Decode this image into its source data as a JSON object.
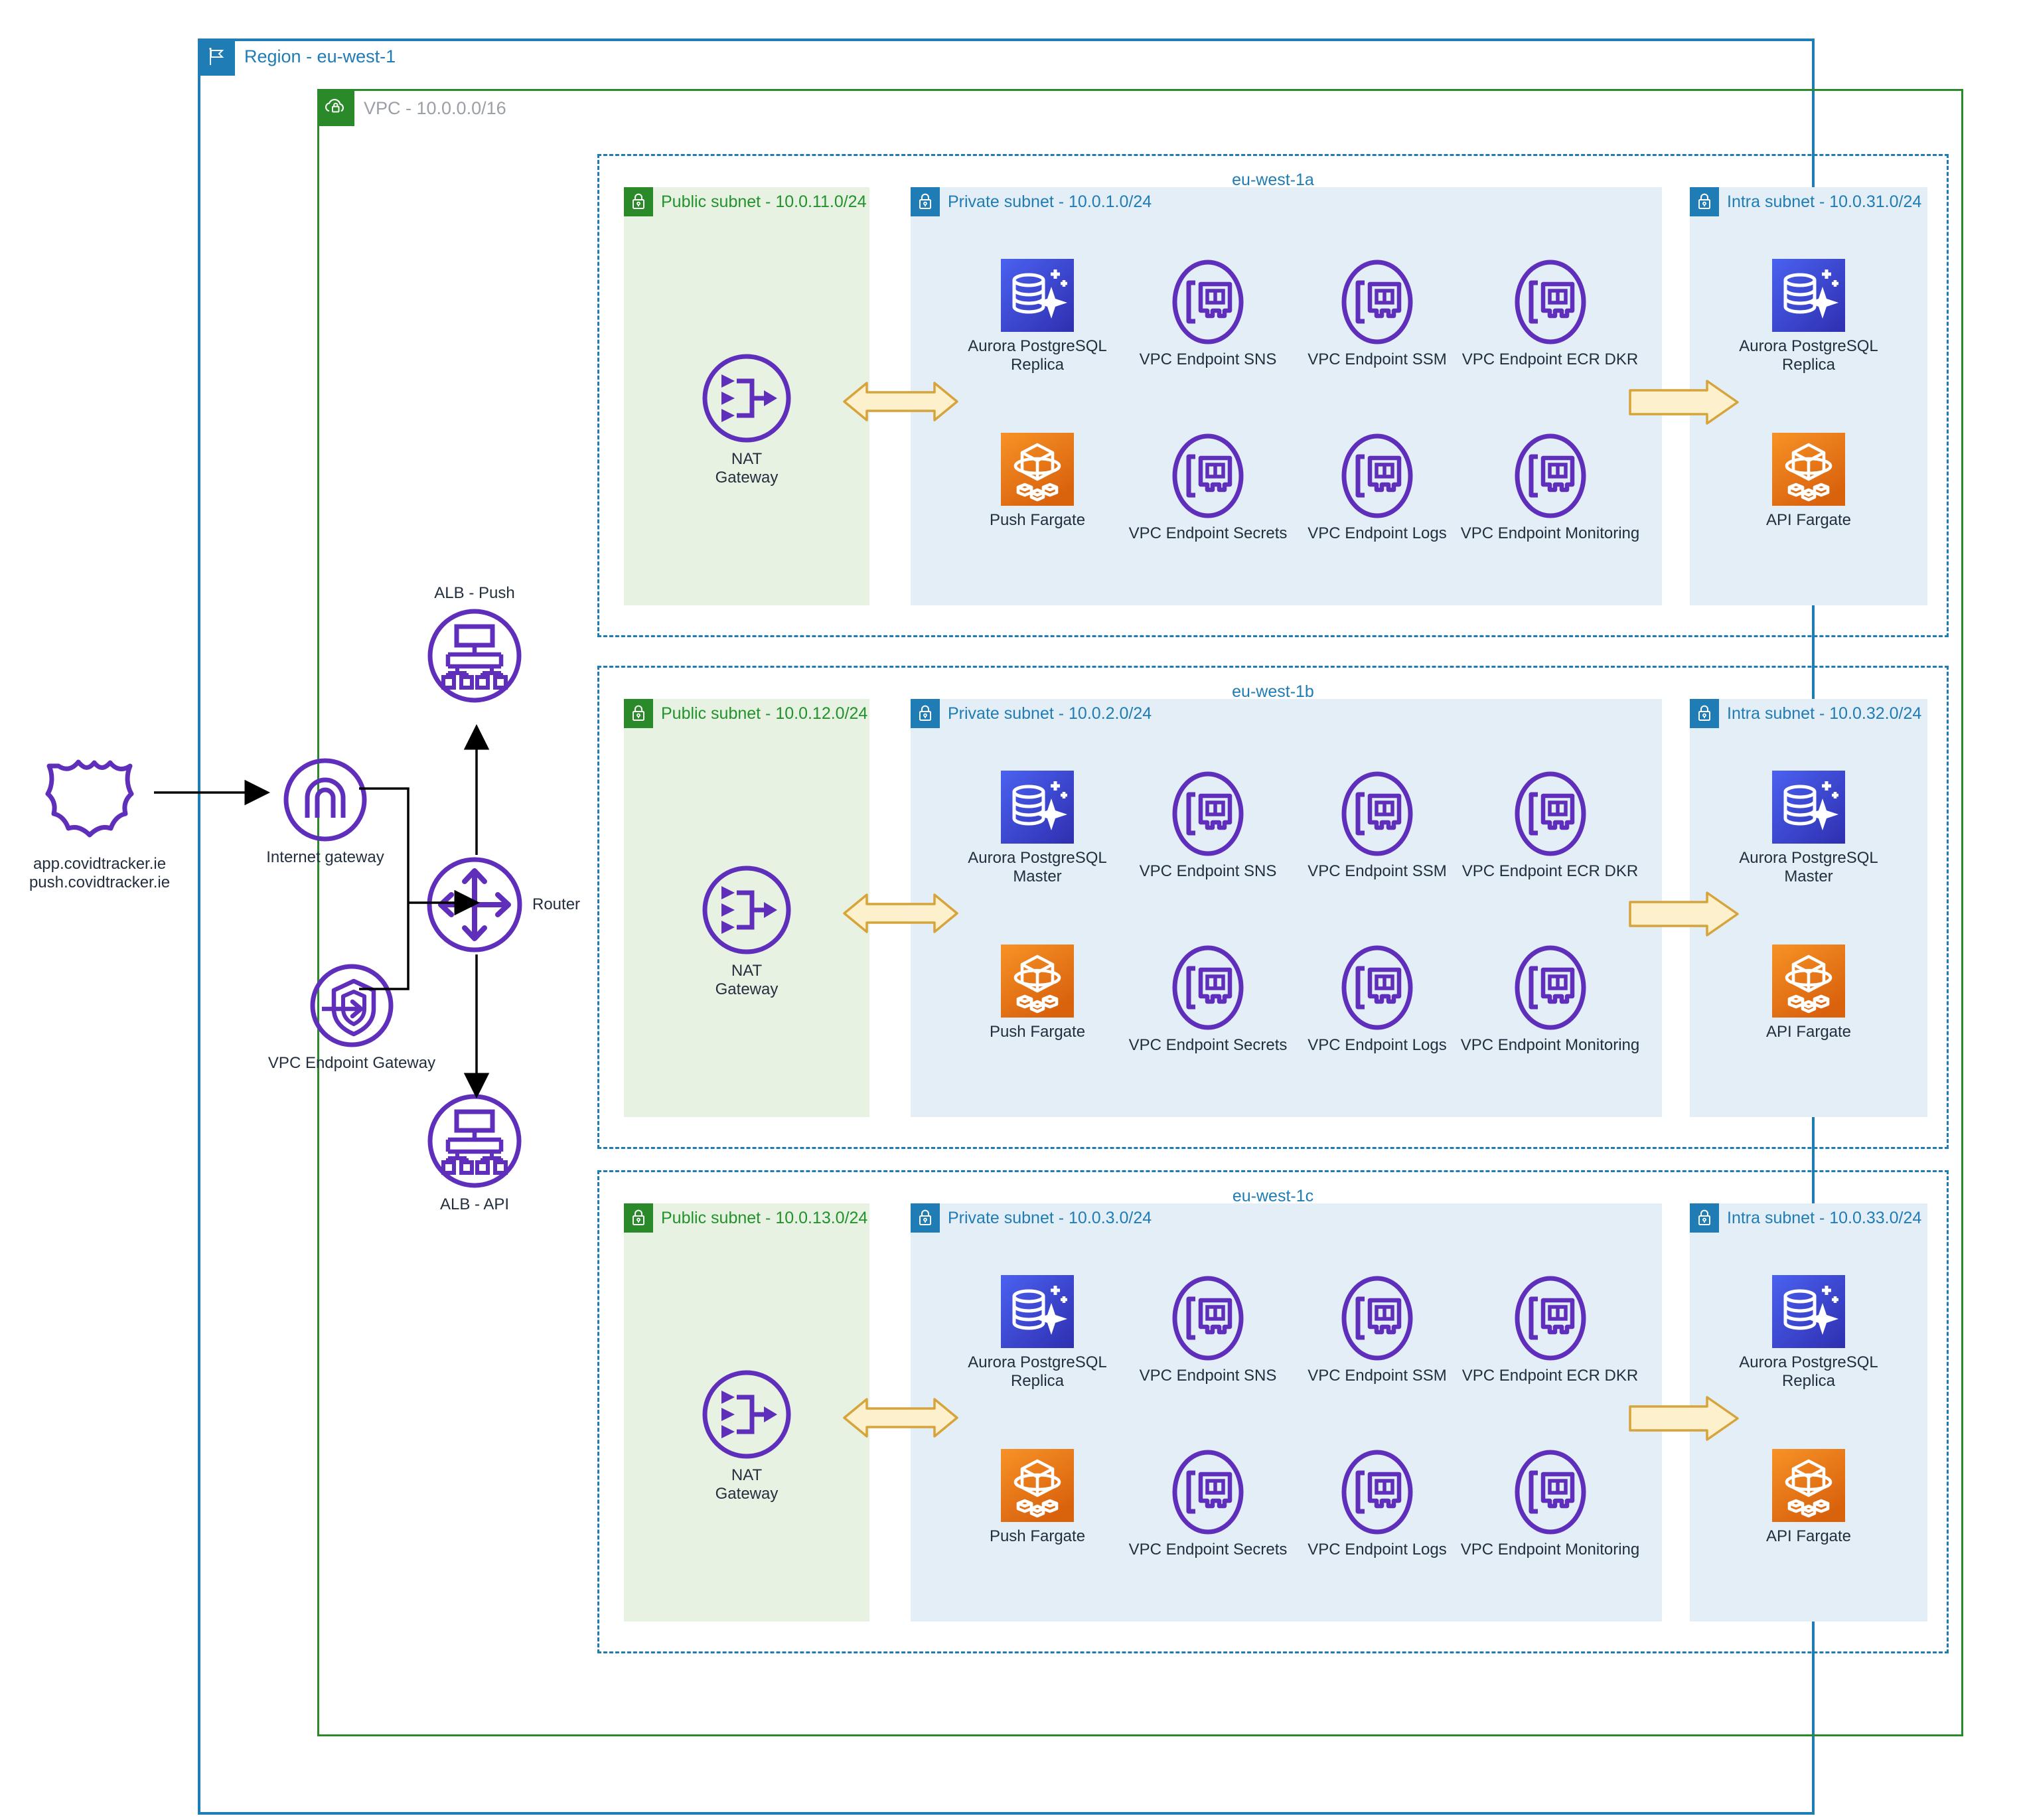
{
  "diagram": {
    "region": {
      "label": "Region - eu-west-1",
      "icon": "region-flag-icon"
    },
    "vpc": {
      "label": "VPC - 10.0.0.0/16",
      "icon": "vpc-cloud-lock-icon"
    }
  },
  "edge": {
    "domains": "app.covidtracker.ie\npush.covidtracker.ie",
    "domains_icon": "shield-icon",
    "internet_gateway": {
      "label": "Internet gateway",
      "icon": "internet-gateway-icon"
    },
    "vpc_endpoint_gateway": {
      "label": "VPC Endpoint Gateway",
      "icon": "vpc-endpoint-gateway-icon"
    },
    "router": {
      "label": "Router",
      "icon": "router-icon"
    },
    "alb_push": {
      "label": "ALB - Push",
      "icon": "application-load-balancer-icon"
    },
    "alb_api": {
      "label": "ALB - API",
      "icon": "application-load-balancer-icon"
    }
  },
  "azs": [
    {
      "name": "eu-west-1a",
      "public": {
        "label": "Public subnet - 10.0.11.0/24",
        "icon": "lock-icon"
      },
      "private": {
        "label": "Private subnet - 10.0.1.0/24",
        "icon": "lock-icon"
      },
      "intra": {
        "label": "Intra subnet - 10.0.31.0/24",
        "icon": "lock-icon"
      },
      "nat": {
        "label": "NAT Gateway",
        "icon": "nat-gateway-icon"
      },
      "db": {
        "label": "Aurora PostgreSQL\nReplica",
        "icon": "aurora-postgresql-icon"
      },
      "fargate": {
        "label": "Push Fargate",
        "icon": "fargate-icon"
      },
      "endpoints_top": [
        {
          "label": "VPC Endpoint SNS",
          "icon": "network-interface-icon"
        },
        {
          "label": "VPC Endpoint SSM",
          "icon": "network-interface-icon"
        },
        {
          "label": "VPC Endpoint ECR DKR",
          "icon": "network-interface-icon"
        }
      ],
      "endpoints_bottom": [
        {
          "label": "VPC Endpoint Secrets",
          "icon": "network-interface-icon"
        },
        {
          "label": "VPC Endpoint Logs",
          "icon": "network-interface-icon"
        },
        {
          "label": "VPC Endpoint Monitoring",
          "icon": "network-interface-icon"
        }
      ],
      "intra_db": {
        "label": "Aurora PostgreSQL\nReplica",
        "icon": "aurora-postgresql-icon"
      },
      "intra_fargate": {
        "label": "API Fargate",
        "icon": "fargate-icon"
      }
    },
    {
      "name": "eu-west-1b",
      "public": {
        "label": "Public subnet - 10.0.12.0/24",
        "icon": "lock-icon"
      },
      "private": {
        "label": "Private subnet - 10.0.2.0/24",
        "icon": "lock-icon"
      },
      "intra": {
        "label": "Intra subnet - 10.0.32.0/24",
        "icon": "lock-icon"
      },
      "nat": {
        "label": "NAT Gateway",
        "icon": "nat-gateway-icon"
      },
      "db": {
        "label": "Aurora PostgreSQL\nMaster",
        "icon": "aurora-postgresql-icon"
      },
      "fargate": {
        "label": "Push Fargate",
        "icon": "fargate-icon"
      },
      "endpoints_top": [
        {
          "label": "VPC Endpoint SNS",
          "icon": "network-interface-icon"
        },
        {
          "label": "VPC Endpoint SSM",
          "icon": "network-interface-icon"
        },
        {
          "label": "VPC Endpoint ECR DKR",
          "icon": "network-interface-icon"
        }
      ],
      "endpoints_bottom": [
        {
          "label": "VPC Endpoint Secrets",
          "icon": "network-interface-icon"
        },
        {
          "label": "VPC Endpoint Logs",
          "icon": "network-interface-icon"
        },
        {
          "label": "VPC Endpoint Monitoring",
          "icon": "network-interface-icon"
        }
      ],
      "intra_db": {
        "label": "Aurora PostgreSQL\nMaster",
        "icon": "aurora-postgresql-icon"
      },
      "intra_fargate": {
        "label": "API Fargate",
        "icon": "fargate-icon"
      }
    },
    {
      "name": "eu-west-1c",
      "public": {
        "label": "Public subnet - 10.0.13.0/24",
        "icon": "lock-icon"
      },
      "private": {
        "label": "Private subnet - 10.0.3.0/24",
        "icon": "lock-icon"
      },
      "intra": {
        "label": "Intra subnet - 10.0.33.0/24",
        "icon": "lock-icon"
      },
      "nat": {
        "label": "NAT Gateway",
        "icon": "nat-gateway-icon"
      },
      "db": {
        "label": "Aurora PostgreSQL\nReplica",
        "icon": "aurora-postgresql-icon"
      },
      "fargate": {
        "label": "Push Fargate",
        "icon": "fargate-icon"
      },
      "endpoints_top": [
        {
          "label": "VPC Endpoint SNS",
          "icon": "network-interface-icon"
        },
        {
          "label": "VPC Endpoint SSM",
          "icon": "network-interface-icon"
        },
        {
          "label": "VPC Endpoint ECR DKR",
          "icon": "network-interface-icon"
        }
      ],
      "endpoints_bottom": [
        {
          "label": "VPC Endpoint Secrets",
          "icon": "network-interface-icon"
        },
        {
          "label": "VPC Endpoint Logs",
          "icon": "network-interface-icon"
        },
        {
          "label": "VPC Endpoint Monitoring",
          "icon": "network-interface-icon"
        }
      ],
      "intra_db": {
        "label": "Aurora PostgreSQL\nReplica",
        "icon": "aurora-postgresql-icon"
      },
      "intra_fargate": {
        "label": "API Fargate",
        "icon": "fargate-icon"
      }
    }
  ],
  "colors": {
    "region_blue": "#1f7cb4",
    "vpc_green": "#2a8a2a",
    "aws_purple": "#5f2fbb",
    "fargate_orange": "#e8830c",
    "aurora_blue": "#3b48cc",
    "arrow_yellow": "#fdf0cd",
    "arrow_yellow_border": "#d6a43a",
    "public_subnet_bg": "#e8f2e3",
    "private_subnet_bg": "#e3eef7",
    "text_dark": "#232f3e"
  }
}
